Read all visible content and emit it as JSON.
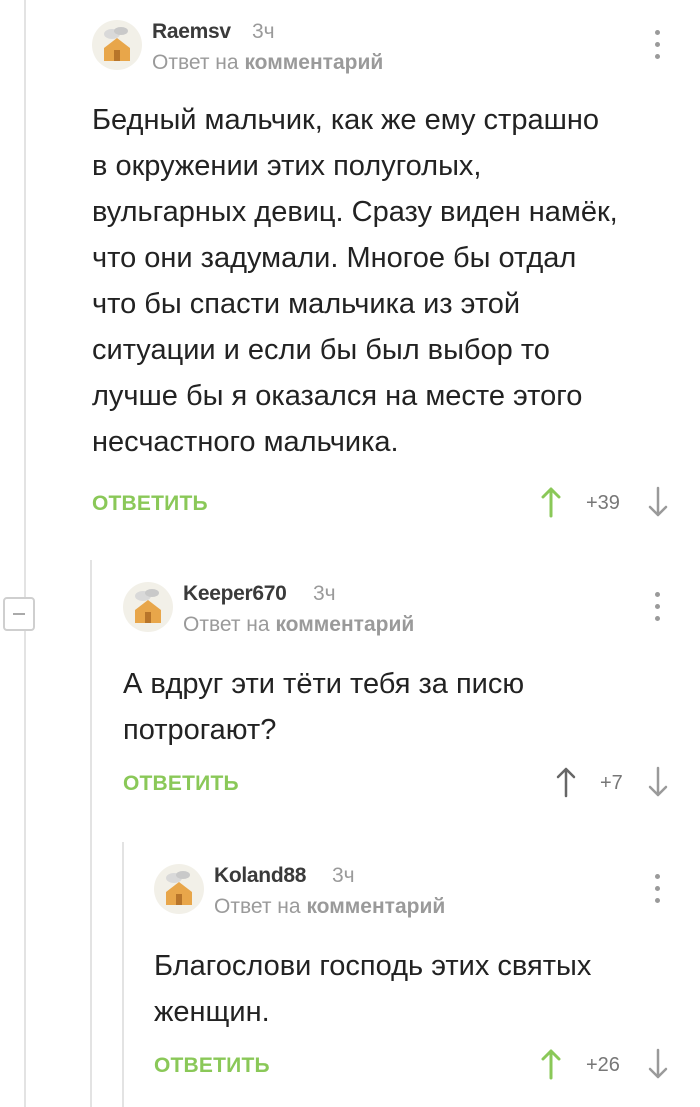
{
  "colors": {
    "accent_green": "#8ac858",
    "muted": "#9a9a9a",
    "text": "#222222",
    "line": "#e3e3e3"
  },
  "comments": [
    {
      "author": "Raemsv",
      "time": "3ч",
      "reply_prefix": "Ответ на",
      "reply_target": "комментарий",
      "text": "Бедный мальчик, как же ему страшно\nв окружении этих полуголых,\nвульгарных девиц. Сразу виден намёк,\nчто они задумали. Многое бы отдал\nчто бы спасти мальчика из этой\nситуации и если бы был выбор то\nлучше бы я оказался на месте этого\nнесчастного мальчика.",
      "reply_label": "ОТВЕТИТЬ",
      "rating": "+39",
      "upvoted": true
    },
    {
      "author": "Keeper670",
      "time": "3ч",
      "reply_prefix": "Ответ на",
      "reply_target": "комментарий",
      "text": "А вдруг эти тёти тебя за писю\nпотрогают?",
      "reply_label": "ОТВЕТИТЬ",
      "rating": "+7",
      "upvoted": false
    },
    {
      "author": "Koland88",
      "time": "3ч",
      "reply_prefix": "Ответ на",
      "reply_target": "комментарий",
      "text": "Благослови господь этих святых\nженщин.",
      "reply_label": "ОТВЕТИТЬ",
      "rating": "+26",
      "upvoted": true
    }
  ]
}
